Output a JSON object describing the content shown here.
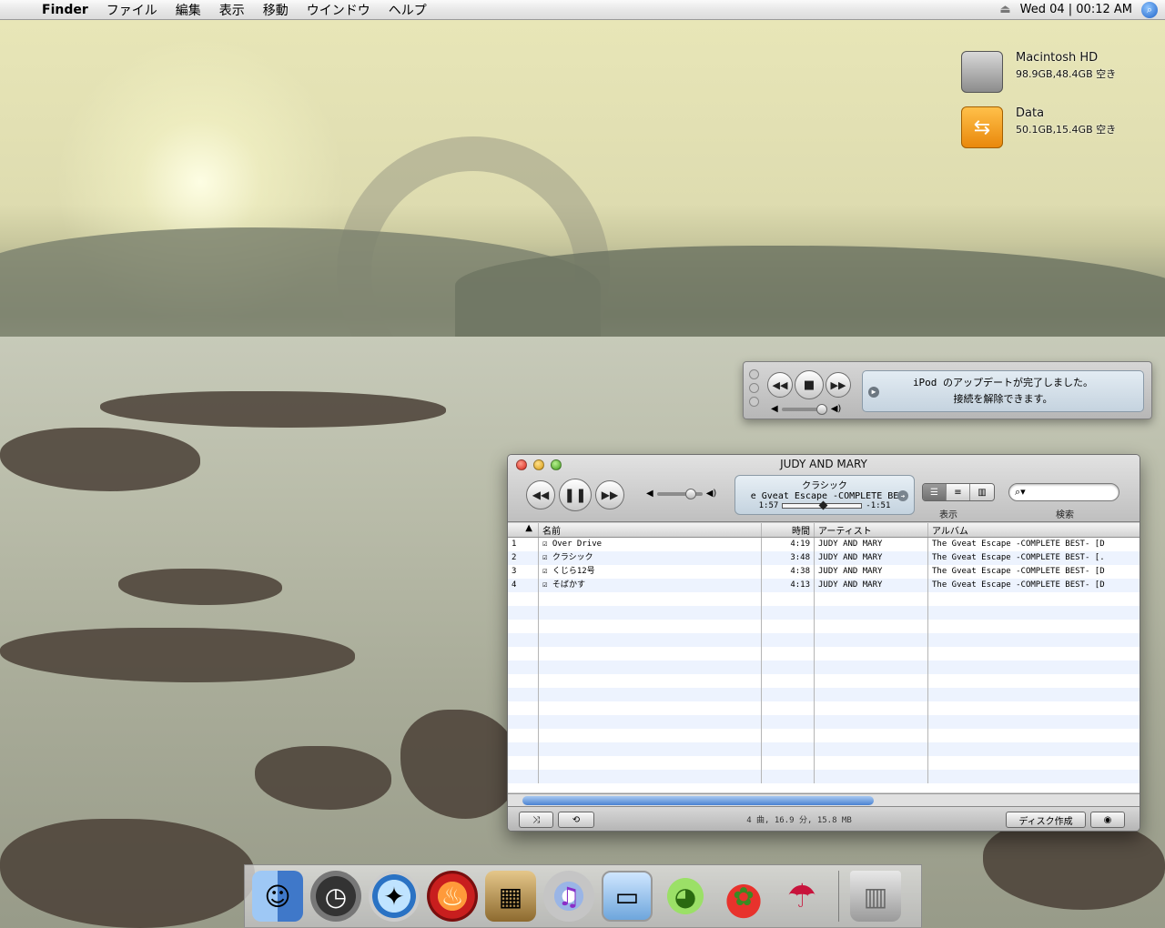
{
  "menubar": {
    "app_name": "Finder",
    "items": [
      "ファイル",
      "編集",
      "表示",
      "移動",
      "ウインドウ",
      "ヘルプ"
    ],
    "clock": "Wed 04 | 00:12 AM"
  },
  "desktop_icons": [
    {
      "name": "Macintosh HD",
      "info": "98.9GB,48.4GB 空き"
    },
    {
      "name": "Data",
      "info": "50.1GB,15.4GB 空き"
    }
  ],
  "mini_player": {
    "message_line1": "iPod のアップデートが完了しました。",
    "message_line2": "接続を解除できます。"
  },
  "itunes": {
    "window_title": "JUDY AND MARY",
    "lcd": {
      "line1": "クラシック",
      "line2": "e Gveat Escape -COMPLETE BE",
      "elapsed": "1:57",
      "remaining": "-1:51",
      "progress": 0.51
    },
    "volume": 0.75,
    "view_label": "表示",
    "search_label": "検索",
    "columns": {
      "name": "名前",
      "time": "時間",
      "artist": "アーティスト",
      "album": "アルバム"
    },
    "tracks": [
      {
        "num": "1",
        "name": "Over Drive",
        "time": "4:19",
        "artist": "JUDY AND MARY",
        "album": "The Gveat Escape -COMPLETE BEST- [D"
      },
      {
        "num": "2",
        "name": "クラシック",
        "time": "3:48",
        "artist": "JUDY AND MARY",
        "album": "The Gveat Escape -COMPLETE BEST- [."
      },
      {
        "num": "3",
        "name": "くじら12号",
        "time": "4:38",
        "artist": "JUDY AND MARY",
        "album": "The Gveat Escape -COMPLETE BEST- [D"
      },
      {
        "num": "4",
        "name": "そばかす",
        "time": "4:13",
        "artist": "JUDY AND MARY",
        "album": "The Gveat Escape -COMPLETE BEST- [D"
      }
    ],
    "status": "4 曲, 16.9 分, 15.8 MB",
    "burn_label": "ディスク作成"
  },
  "dock": {
    "icons": [
      "finder-icon",
      "clock-icon",
      "safari-icon",
      "fire-icon",
      "iphoto-icon",
      "itunes-icon",
      "iphone-icon",
      "adium-icon",
      "strawberry-icon",
      "umbrella-icon",
      "trash-icon"
    ]
  }
}
